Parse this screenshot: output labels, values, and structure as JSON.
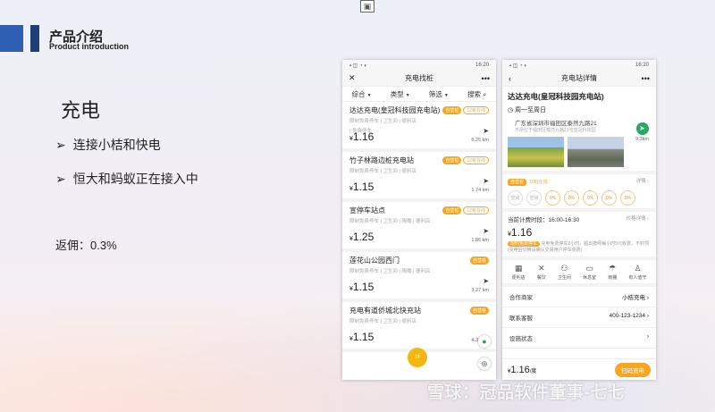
{
  "header": {
    "title": "产品介绍",
    "subtitle": "Product introduction"
  },
  "slide": {
    "main_title": "充电",
    "bullets": [
      "连接小桔和快电",
      "恒大和蚂蚁正在接入中"
    ],
    "bullet_glyph": "➢",
    "rebate": "返佣：0.3%"
  },
  "status_time": "16:20",
  "list_screen": {
    "nav_title": "充电找桩",
    "close": "✕",
    "more": "•••",
    "filters": [
      "综合",
      "类型",
      "筛选",
      "搜索"
    ],
    "stations": [
      {
        "name": "达达充电(皇冠科技园充电站)",
        "tags": "限制免费停车 | 卫生间 | 便利店",
        "park": "| 免费停车",
        "price": "1.16",
        "dist": "6.25 km",
        "badges": [
          "自营桩",
          "12桩在线"
        ]
      },
      {
        "name": "竹子林路边桩充电站",
        "tags": "限制免费停车 | 卫生间 | 便利店",
        "park": "",
        "price": "1.15",
        "dist": "1.74 km",
        "badges": [
          "自营桩",
          "12桩在线"
        ]
      },
      {
        "name": "宣停车站点",
        "tags": "限制免费停车 | 卫生间 | 隔楼 | 便利店",
        "park": "",
        "price": "1.25",
        "dist": "1.86 km",
        "badges": [
          "自营桩",
          "12桩在线"
        ]
      },
      {
        "name": "莲花山公园西门",
        "tags": "限制免费停车 | 卫生间 | 隔楼 | 便利店",
        "park": "",
        "price": "1.15",
        "dist": "3.27 km",
        "badges": [
          "自营桩"
        ]
      },
      {
        "name": "充电有道侨城北快充站",
        "tags": "限制免费停车 | 卫生间 | 便利店",
        "park": "",
        "price": "1.15",
        "dist": "4.31 km",
        "badges": [
          "自营桩"
        ]
      }
    ],
    "currency": "¥"
  },
  "detail_screen": {
    "nav_title": "充电站详情",
    "back": "‹",
    "more": "•••",
    "name": "达达充电(皇冠科技园充电站)",
    "hours": "周一至周日",
    "address": "广东省深圳市福田区泰然九路21",
    "address_sub": "市场位于福田区泰然九路21号皇冠科技园",
    "distance": "9.3km",
    "pile_tags": [
      "自营桩",
      "12桩在线"
    ],
    "pile_detail": "详情 ›",
    "circles": [
      {
        "label": "空闲",
        "busy": false
      },
      {
        "label": "空闲",
        "busy": false
      },
      {
        "label": "0%",
        "busy": true
      },
      {
        "label": "0%",
        "busy": true
      },
      {
        "label": "0%",
        "busy": true
      },
      {
        "label": "0%",
        "busy": true
      },
      {
        "label": "0%",
        "busy": true
      }
    ],
    "period": "当前计费时段：16:00-16:30",
    "period_detail": "价格详情 ›",
    "price": "1.16",
    "notice_tag": "限时免费停车",
    "notice": "充电免费停车2小时，超出按照每小时5元收费，不封顶 (充电后切换请确认交易用户停车收费)",
    "amenities": [
      "便利店",
      "餐饮",
      "卫生间",
      "休息室",
      "雨棚",
      "有人值守"
    ],
    "rows": [
      {
        "label": "合作商家",
        "value": "小桔充电 ›"
      },
      {
        "label": "联系客服",
        "value": "400-123-1234 ›"
      },
      {
        "label": "设施状态",
        "value": "›"
      }
    ],
    "bottom_price": "1.16",
    "bottom_unit": "/度",
    "action": "扫码充电"
  },
  "watermark": "雪球：冠品软件董事-七七"
}
